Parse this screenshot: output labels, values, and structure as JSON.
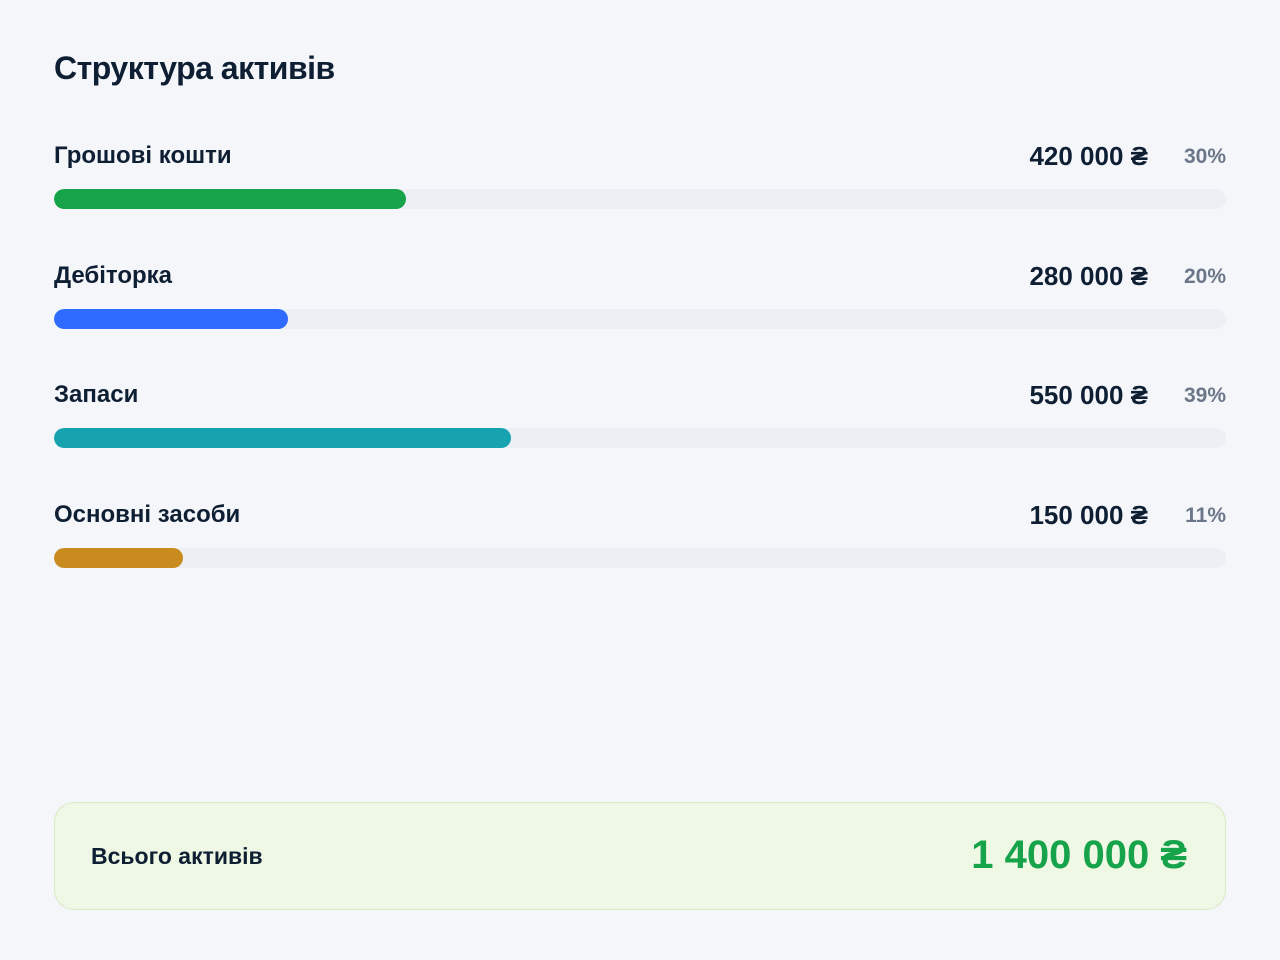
{
  "title": "Структура активів",
  "items": [
    {
      "label": "Грошові кошти",
      "amount": "420 000 ₴",
      "percent": "30%",
      "share": 0.3,
      "color": "#16a34a"
    },
    {
      "label": "Дебіторка",
      "amount": "280 000 ₴",
      "percent": "20%",
      "share": 0.2,
      "color": "#2f6bff"
    },
    {
      "label": "Запаси",
      "amount": "550 000 ₴",
      "percent": "39%",
      "share": 0.39,
      "color": "#16a2ae"
    },
    {
      "label": "Основні засоби",
      "amount": "150 000 ₴",
      "percent": "11%",
      "share": 0.11,
      "color": "#c98a1e"
    }
  ],
  "total": {
    "label": "Всього активів",
    "value": "1 400 000 ₴"
  }
}
